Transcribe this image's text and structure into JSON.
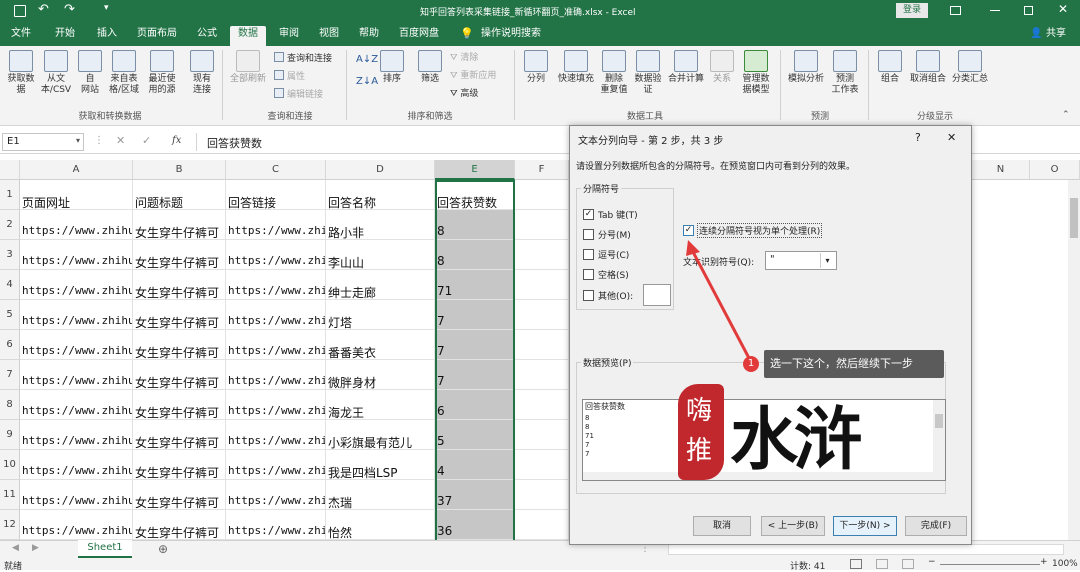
{
  "titlebar": {
    "save_icon": "save-icon",
    "undo_icon": "undo-icon",
    "redo_icon": "redo-icon",
    "title": "知乎回答列表采集链接_新循环翻页_准确.xlsx  -  Excel",
    "login": "登录"
  },
  "menu": {
    "tabs": [
      "文件",
      "开始",
      "插入",
      "页面布局",
      "公式",
      "数据",
      "审阅",
      "视图",
      "帮助",
      "百度网盘"
    ],
    "active": "数据",
    "tell_me": "操作说明搜索",
    "share": "共享"
  },
  "ribbon": {
    "get_data": "获取数\n据",
    "from_text": "从文\n本/CSV",
    "from_web": "自\n网站",
    "from_table": "来自表\n格/区域",
    "recent": "最近使\n用的源",
    "existing": "现有\n连接",
    "group1": "获取和转换数据",
    "refresh_all": "全部刷新",
    "queries": "查询和连接",
    "properties": "属性",
    "edit_links": "编辑链接",
    "group2": "查询和连接",
    "sort": "排序",
    "filter": "筛选",
    "clear": "清除",
    "reapply": "重新应用",
    "advanced": "高级",
    "group3": "排序和筛选",
    "text_to_cols": "分列",
    "flash_fill": "快速填充",
    "remove_dup": "删除\n重复值",
    "validation": "数据验\n证",
    "consolidate": "合并计算",
    "relations": "关系",
    "data_model": "管理数\n据模型",
    "group4": "数据工具",
    "what_if": "模拟分析",
    "forecast": "预测\n工作表",
    "group5": "预测",
    "group_btn": "组合",
    "ungroup": "取消组合",
    "subtotal": "分类汇总",
    "group6": "分级显示"
  },
  "formula_bar": {
    "name_box": "E1",
    "fx": "fx",
    "value": "回答获赞数"
  },
  "grid": {
    "columns": [
      "A",
      "B",
      "C",
      "D",
      "E",
      "F",
      "N",
      "O"
    ],
    "rows": [
      {
        "n": "1",
        "a": "页面网址",
        "b": "问题标题",
        "c": "回答链接",
        "d": "回答名称",
        "e": "回答获赞数"
      },
      {
        "n": "2",
        "a": "https://www.zhihu",
        "b": "女生穿牛仔裤可",
        "c": "https://www.zhil",
        "d": "路小非",
        "e": "8"
      },
      {
        "n": "3",
        "a": "https://www.zhihu",
        "b": "女生穿牛仔裤可",
        "c": "https://www.zhil",
        "d": "李山山",
        "e": "8"
      },
      {
        "n": "4",
        "a": "https://www.zhihu",
        "b": "女生穿牛仔裤可",
        "c": "https://www.zhil",
        "d": "绅士走廊",
        "e": "71"
      },
      {
        "n": "5",
        "a": "https://www.zhihu",
        "b": "女生穿牛仔裤可",
        "c": "https://www.zhil",
        "d": "灯塔",
        "e": "7"
      },
      {
        "n": "6",
        "a": "https://www.zhihu",
        "b": "女生穿牛仔裤可",
        "c": "https://www.zhil",
        "d": "番番美衣",
        "e": "7"
      },
      {
        "n": "7",
        "a": "https://www.zhihu",
        "b": "女生穿牛仔裤可",
        "c": "https://www.zhil",
        "d": "微胖身材",
        "e": "7"
      },
      {
        "n": "8",
        "a": "https://www.zhihu",
        "b": "女生穿牛仔裤可",
        "c": "https://www.zhil",
        "d": "海龙王",
        "e": "6"
      },
      {
        "n": "9",
        "a": "https://www.zhihu",
        "b": "女生穿牛仔裤可",
        "c": "https://www.zhil",
        "d": "小彩旗最有范儿",
        "e": "5"
      },
      {
        "n": "10",
        "a": "https://www.zhihu",
        "b": "女生穿牛仔裤可",
        "c": "https://www.zhil",
        "d": "我是四档LSP",
        "e": "4"
      },
      {
        "n": "11",
        "a": "https://www.zhihu",
        "b": "女生穿牛仔裤可",
        "c": "https://www.zhil",
        "d": "杰瑞",
        "e": "37"
      },
      {
        "n": "12",
        "a": "https://www.zhihu",
        "b": "女生穿牛仔裤可",
        "c": "https://www.zhil",
        "d": "怡然",
        "e": "36"
      }
    ]
  },
  "sheet": {
    "name": "Sheet1",
    "add": "⊕"
  },
  "status": {
    "left": "就绪",
    "count": "计数: 41",
    "zoom": "100%"
  },
  "dialog": {
    "title": "文本分列向导 - 第 2 步，共 3 步",
    "help": "?",
    "close": "✕",
    "desc": "请设置分列数据所包含的分隔符号。在预览窗口内可看到分列的效果。",
    "delim_group": "分隔符号",
    "tab": "Tab 键(T)",
    "semicolon": "分号(M)",
    "comma": "逗号(C)",
    "space": "空格(S)",
    "other": "其他(O):",
    "consecutive": "连续分隔符号视为单个处理(R)",
    "qualifier_label": "文本识别符号(Q):",
    "qualifier_value": "\"",
    "preview_label": "数据预览(P)",
    "preview_lines": [
      "回答获赞数",
      "8",
      "8",
      "71",
      "7",
      "7"
    ],
    "cancel": "取消",
    "back": "< 上一步(B)",
    "next": "下一步(N) >",
    "finish": "完成(F)"
  },
  "annotation": {
    "badge": "1",
    "text": "选一下这个，然后继续下一步"
  },
  "watermark": {
    "seal_1": "嗨",
    "seal_2": "推",
    "big": "水浒"
  },
  "colors": {
    "excel_green": "#227447",
    "selection_gray": "#c6c6c6",
    "annotation_red": "#e23b3b"
  }
}
